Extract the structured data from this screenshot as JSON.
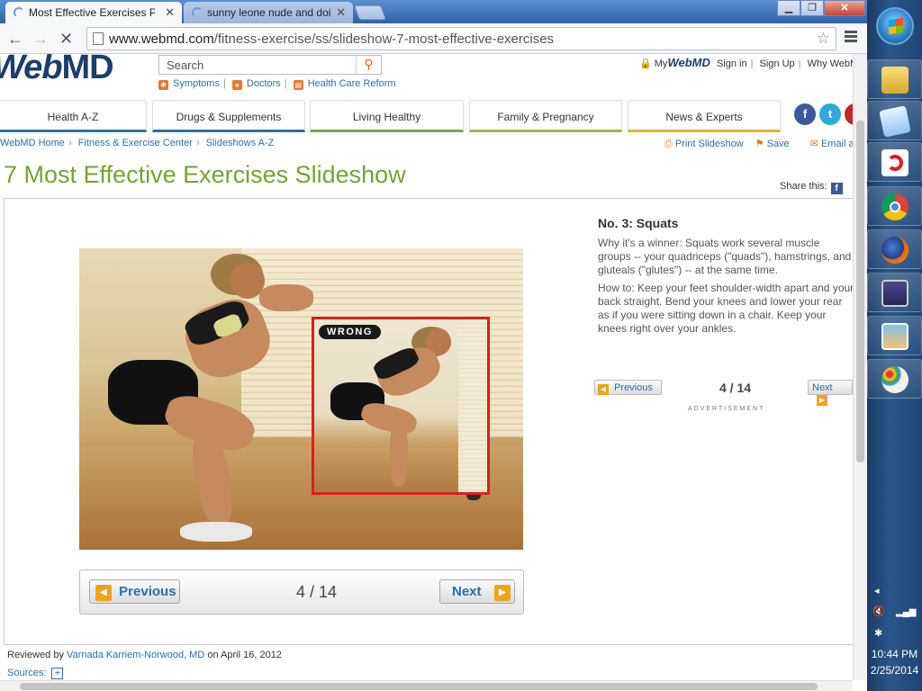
{
  "browser": {
    "tabs": [
      {
        "label": "Most Effective Exercises Pi",
        "active": true
      },
      {
        "label": "sunny leone nude and doi",
        "active": false
      }
    ],
    "url_host": "www.webmd.com",
    "url_path": "/fitness-exercise/ss/slideshow-7-most-effective-exercises",
    "window_buttons": [
      "minimize",
      "maximize",
      "close"
    ]
  },
  "header": {
    "logo_web": "Web",
    "logo_md": "MD",
    "search_placeholder": "Search",
    "quicklinks": [
      "Symptoms",
      "Doctors",
      "Health Care Reform"
    ],
    "my_prefix": "My",
    "my_logo": "WebMD",
    "user_links": [
      "Sign in",
      "Sign Up",
      "Why WebM"
    ]
  },
  "nav": {
    "tabs": [
      "Health A-Z",
      "Drugs & Supplements",
      "Living Healthy",
      "Family & Pregnancy",
      "News & Experts"
    ],
    "tab_colors": [
      "#2d6fa7",
      "#2d6fa7",
      "#7da74a",
      "#a7b54a",
      "#e0b43b"
    ],
    "social": [
      {
        "name": "facebook",
        "glyph": "f",
        "color": "#3b5998"
      },
      {
        "name": "twitter",
        "glyph": "t",
        "color": "#2ea8e1"
      },
      {
        "name": "pinterest",
        "glyph": "p",
        "color": "#cc2127"
      }
    ]
  },
  "breadcrumb": [
    "WebMD Home",
    "Fitness & Exercise Center",
    "Slideshows A-Z"
  ],
  "tools": {
    "print": "Print Slideshow",
    "save": "Save",
    "email": "Email a Fr"
  },
  "page_title": "7 Most Effective Exercises Slideshow",
  "share_label": "Share this:",
  "slide": {
    "wrong_label": "WRONG",
    "title": "No. 3: Squats",
    "why": "Why it's a winner: Squats work several muscle groups -- your quadriceps (\"quads\"), hamstrings, and gluteals (\"glutes\") -- at the same time.",
    "howto": "How to: Keep your feet shoulder-width apart and your back straight. Bend your knees and lower your rear as if you were sitting down in a chair. Keep your knees right over your ankles."
  },
  "pager": {
    "previous": "Previous",
    "next": "Next",
    "count": "4 / 14"
  },
  "advertisement": "ADVERTISEMENT",
  "review": {
    "prefix": "Reviewed by",
    "reviewer": "Varnada Karriem-Norwood, MD",
    "date": "on April 16, 2012"
  },
  "sources_label": "Sources:",
  "taskbar": {
    "apps": [
      "file-explorer",
      "notepad",
      "airtel",
      "chrome",
      "firefox",
      "remote-desktop",
      "photo-viewer",
      "paint"
    ],
    "time": "10:44 PM",
    "date": "2/25/2014"
  }
}
